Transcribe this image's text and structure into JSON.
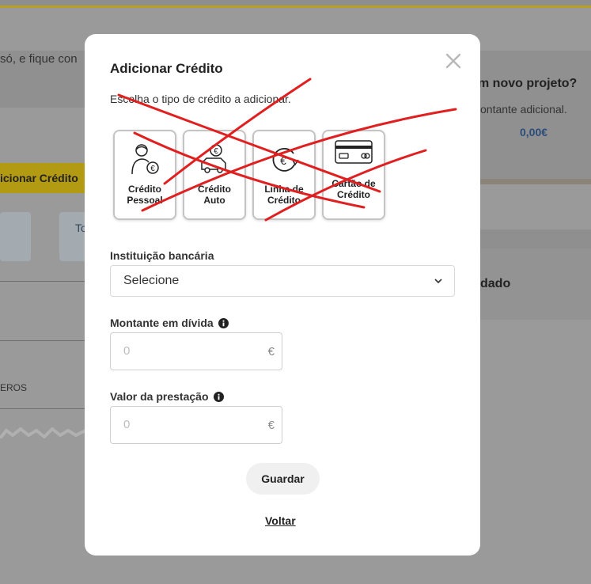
{
  "background": {
    "left_text": "só, e fique con",
    "left_button": "icionar Crédito",
    "left_card_text": "To",
    "left_label": "EROS",
    "right_title": "m novo projeto?",
    "right_sub": "ontante adicional.",
    "right_value": "0,00€",
    "right_heading": "dado"
  },
  "modal": {
    "title": "Adicionar Crédito",
    "subtitle": "Escolha o tipo de crédito a adicionar.",
    "credit_types": [
      {
        "label": "Crédito Pessoal",
        "icon": "person-euro-icon"
      },
      {
        "label": "Crédito Auto",
        "icon": "car-euro-icon"
      },
      {
        "label": "Linha de Crédito",
        "icon": "euro-cycle-icon"
      },
      {
        "label": "Cartão de Crédito",
        "icon": "credit-card-icon"
      }
    ],
    "institution": {
      "label": "Instituição bancária",
      "selected": "Selecione"
    },
    "debt_amount": {
      "label": "Montante em dívida",
      "placeholder": "0",
      "currency": "€"
    },
    "installment": {
      "label": "Valor da prestação",
      "placeholder": "0",
      "currency": "€"
    },
    "save_label": "Guardar",
    "back_label": "Voltar"
  },
  "colors": {
    "accent": "#e0c21d",
    "scribble": "#e02020"
  }
}
